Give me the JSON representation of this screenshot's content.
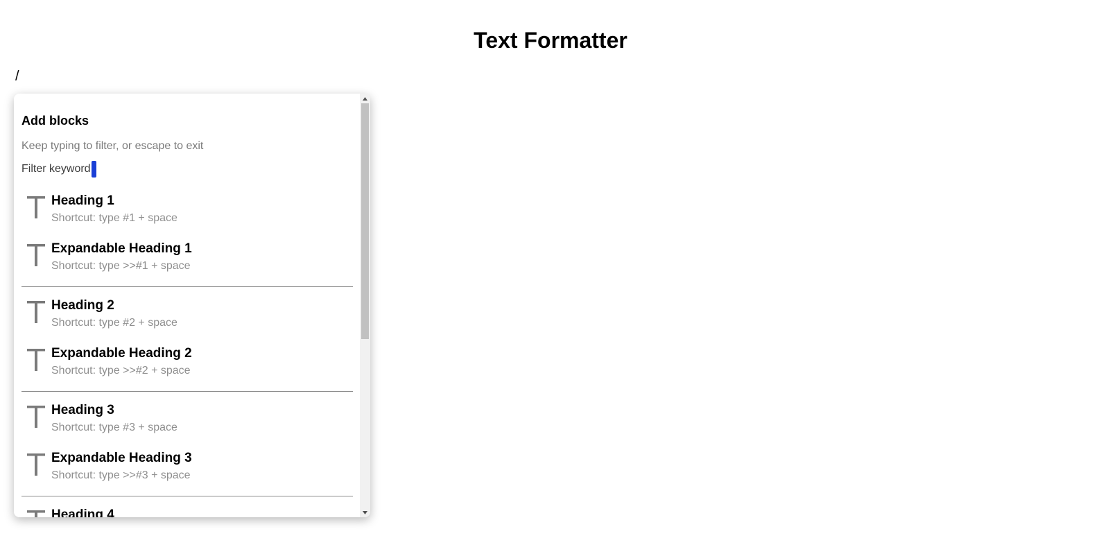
{
  "page": {
    "title": "Text Formatter"
  },
  "editor": {
    "text": "/"
  },
  "menu": {
    "heading": "Add blocks",
    "hint": "Keep typing to filter, or escape to exit",
    "filter_label": "Filter keyword",
    "groups": [
      {
        "items": [
          {
            "title": "Heading 1",
            "shortcut": "Shortcut: type #1 + space",
            "icon": "text-t-icon"
          },
          {
            "title": "Expandable Heading 1",
            "shortcut": "Shortcut: type >>#1 + space",
            "icon": "text-t-icon"
          }
        ]
      },
      {
        "items": [
          {
            "title": "Heading 2",
            "shortcut": "Shortcut: type #2 + space",
            "icon": "text-t-icon"
          },
          {
            "title": "Expandable Heading 2",
            "shortcut": "Shortcut: type >>#2 + space",
            "icon": "text-t-icon"
          }
        ]
      },
      {
        "items": [
          {
            "title": "Heading 3",
            "shortcut": "Shortcut: type #3 + space",
            "icon": "text-t-icon"
          },
          {
            "title": "Expandable Heading 3",
            "shortcut": "Shortcut: type >>#3 + space",
            "icon": "text-t-icon"
          }
        ]
      },
      {
        "items": [
          {
            "title": "Heading 4",
            "icon": "text-t-icon"
          }
        ]
      }
    ]
  },
  "colors": {
    "caret": "#1a3fd6",
    "icon": "#7a7a7a",
    "muted_text": "#8f8f8f"
  }
}
